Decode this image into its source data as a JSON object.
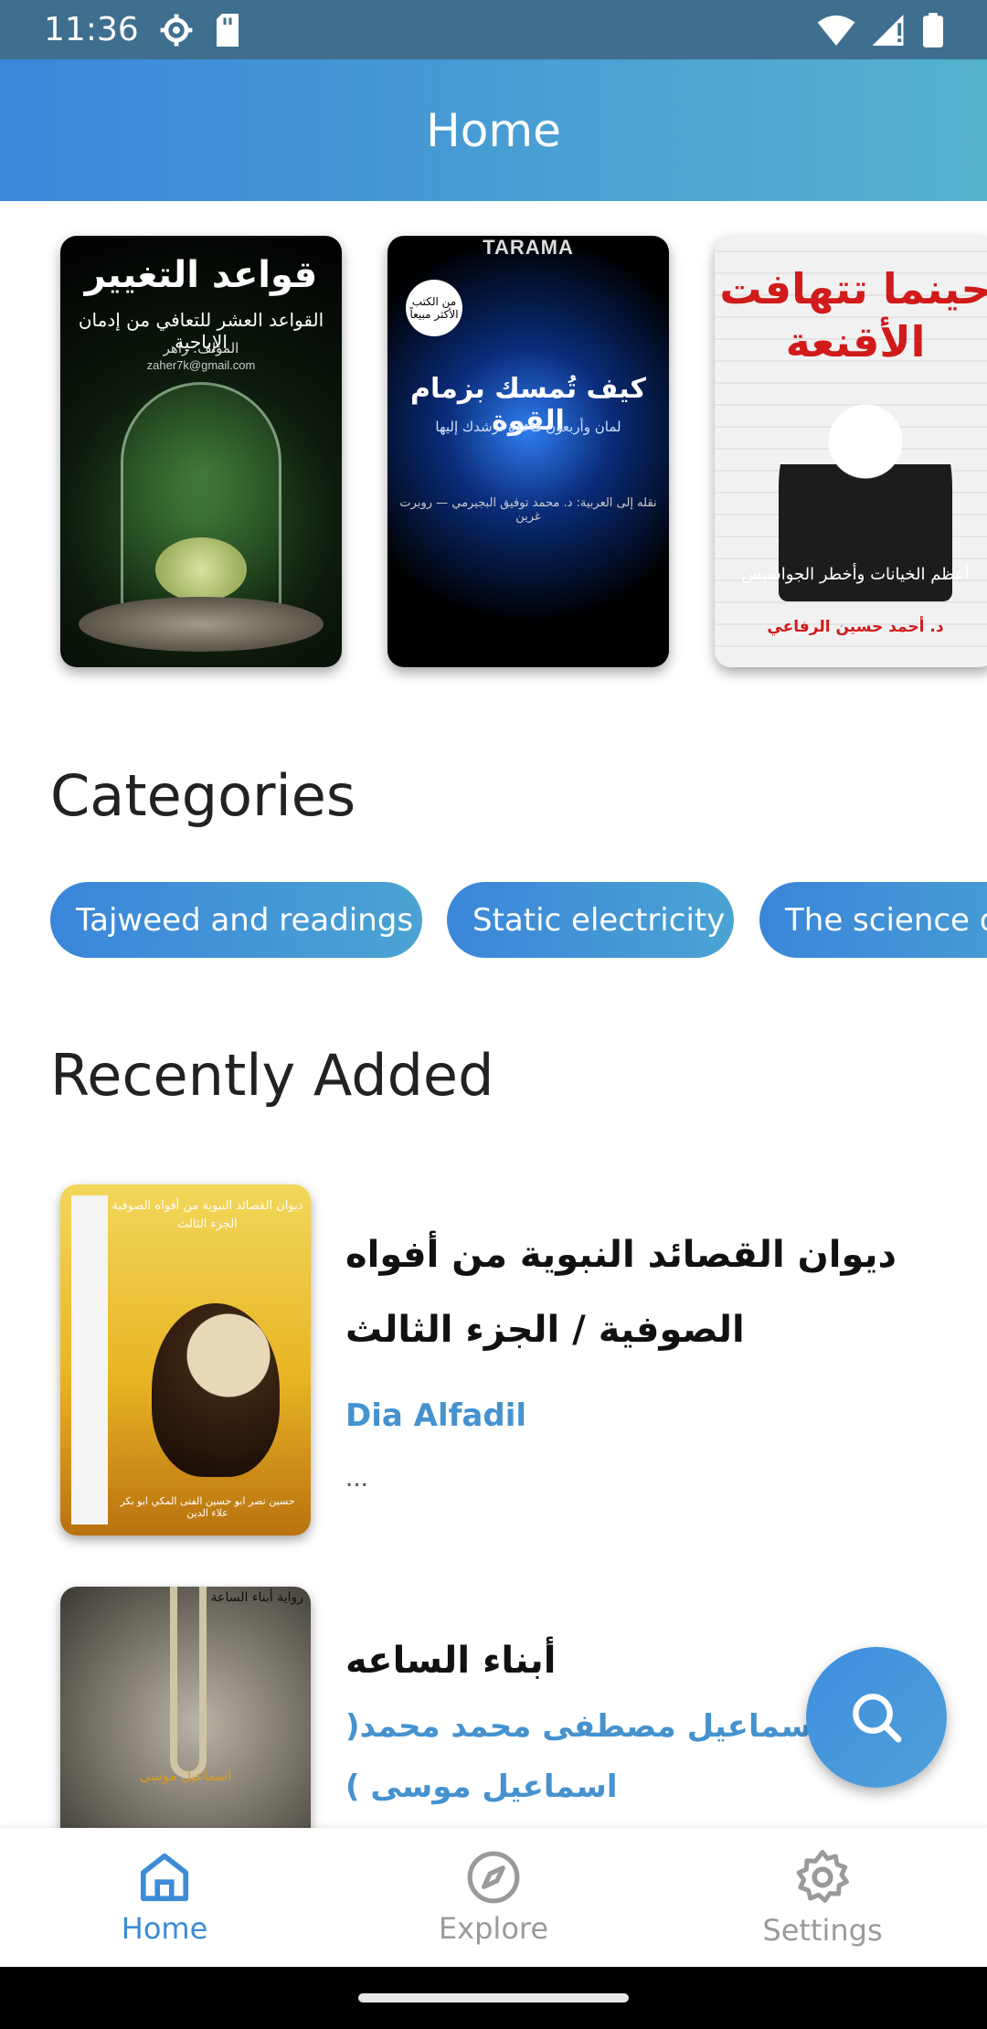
{
  "status_bar": {
    "time": "11:36",
    "icons": [
      "gear-icon",
      "sd-card-icon",
      "wifi-icon",
      "signal-icon",
      "battery-icon"
    ]
  },
  "app_bar": {
    "title": "Home"
  },
  "featured": [
    {
      "title": "قواعد التغيير",
      "subtitle": "القواعد العشر للتعافي من إدمان الإباحية",
      "author": "المؤلف: زاهر",
      "email": "zaher7k@gmail.com"
    },
    {
      "publisher": "TARAMA",
      "badge": "من الكتب الأكثر مبيعاً",
      "title": "كيف تُمسك بزمام القوة",
      "subtitle": "لمان وأربعون قاعدة تُرشدك إليها",
      "credits": "نقله إلى العربية: د. محمد توفيق البجيرمي — روبرت غرين"
    },
    {
      "title": "حينما تتهافت الأقنعة",
      "subtitle": "أعظم الخيانات وأخطر الجواسيس",
      "author": "د. أحمد حسين الرفاعي"
    }
  ],
  "categories": {
    "title": "Categories",
    "items": [
      "Tajweed and readings",
      "Static electricity",
      "The science of"
    ]
  },
  "recent": {
    "title": "Recently Added",
    "items": [
      {
        "title": "ديوان القصائد النبوية من أفواه الصوفية / الجزء الثالث",
        "author": "Dia Alfadil",
        "description": "...",
        "cover_title": "ديوان القصائد النبوية من أفواه الصوفية الجزء الثالث",
        "cover_footer": "حسين نصر ابو حسين الفتى المكي ابو بكر علاء الدين"
      },
      {
        "title": "أبناء الساعه",
        "author": "اسماعيل مصطفى محمد محمد( اسماعيل موسى )",
        "cover_title": "رواية أبناء الساعة",
        "cover_author": "اسماعيل موسى"
      }
    ]
  },
  "bottom_nav": [
    {
      "label": "Home",
      "icon": "home-icon",
      "active": true
    },
    {
      "label": "Explore",
      "icon": "compass-icon",
      "active": false
    },
    {
      "label": "Settings",
      "icon": "settings-icon",
      "active": false
    }
  ],
  "colors": {
    "accent": "#3c8bd8",
    "author_text": "#4592cf",
    "status_bar": "#3f6f8f"
  }
}
